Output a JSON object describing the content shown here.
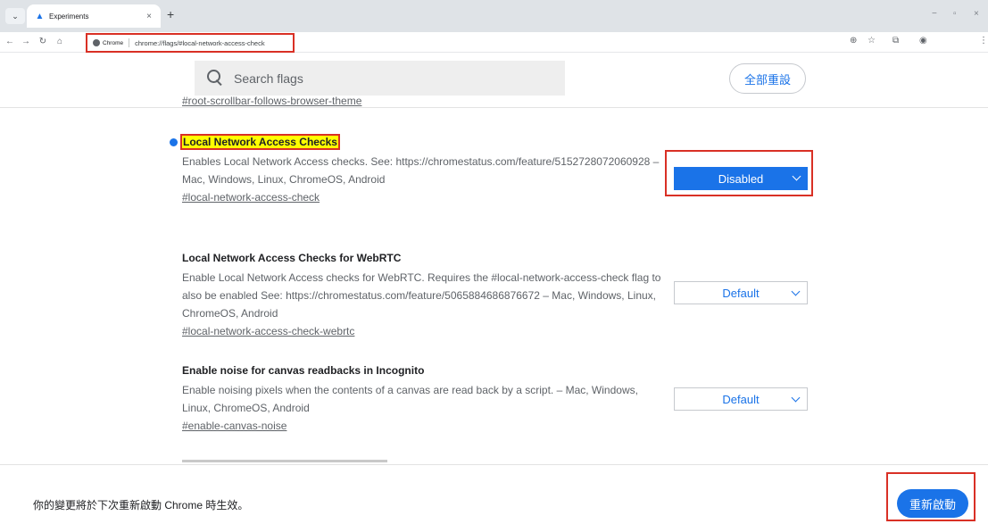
{
  "browser": {
    "tab_search_label": "⌄",
    "tab_title": "Experiments",
    "tab_close": "×",
    "new_tab": "+",
    "window_controls": {
      "minimize": "−",
      "restore": "▫",
      "close": "×"
    },
    "omnibox": {
      "chip_label": "Chrome",
      "url": "chrome://flags/#local-network-access-check"
    }
  },
  "flags_page": {
    "search_placeholder": "Search flags",
    "reset_all_label": "全部重設",
    "cut_off_link": "#root-scrollbar-follows-browser-theme",
    "flags": [
      {
        "title": "Local Network Access Checks",
        "description": "Enables Local Network Access checks. See: https://chromestatus.com/feature/5152728072060928 – Mac, Windows, Linux, ChromeOS, Android",
        "link": "#local-network-access-check",
        "select_value": "Disabled",
        "highlighted": true
      },
      {
        "title": "Local Network Access Checks for WebRTC",
        "description": "Enable Local Network Access checks for WebRTC. Requires the #local-network-access-check flag to also be enabled See: https://chromestatus.com/feature/5065884686876672 – Mac, Windows, Linux, ChromeOS, Android",
        "link": "#local-network-access-check-webrtc",
        "select_value": "Default"
      },
      {
        "title": "Enable noise for canvas readbacks in Incognito",
        "description": "Enable noising pixels when the contents of a canvas are read back by a script. – Mac, Windows, Linux, ChromeOS, Android",
        "link": "#enable-canvas-noise",
        "select_value": "Default"
      }
    ]
  },
  "footer": {
    "message": "你的變更將於下次重新啟動 Chrome 時生效。",
    "relaunch_label": "重新啟動"
  },
  "colors": {
    "accent": "#1a73e8",
    "annotation_red": "#d93025",
    "highlight": "#ffff00"
  }
}
